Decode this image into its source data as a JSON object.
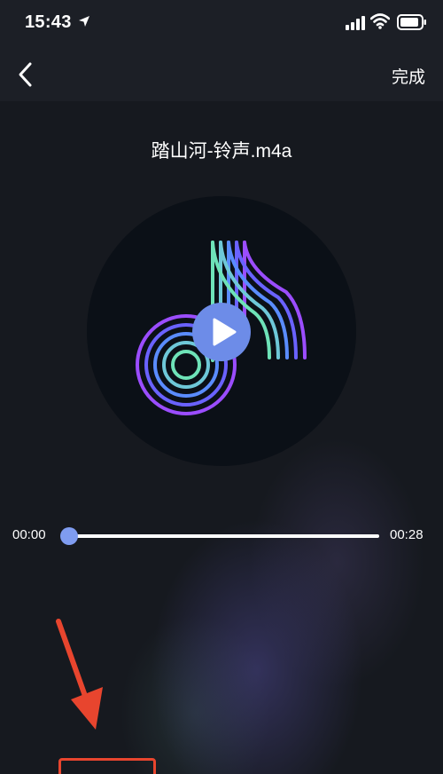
{
  "status_bar": {
    "time": "15:43",
    "icons": [
      "location-arrow-icon",
      "cellular-signal-icon",
      "wifi-icon",
      "battery-icon"
    ]
  },
  "nav": {
    "back_icon": "chevron-left-icon",
    "done_label": "完成"
  },
  "player": {
    "file_name": "踏山河-铃声.m4a",
    "current_time": "00:00",
    "duration": "00:28",
    "progress_fraction": 0.0,
    "play_icon": "play-icon"
  },
  "colors": {
    "accent_blue": "#6d8ce8",
    "knob_blue": "#7f9cf0",
    "annotation_red": "#e8452e",
    "logo_green": "#6ee3b8",
    "logo_purple": "#9b4dff",
    "logo_blue": "#5a8cff"
  }
}
